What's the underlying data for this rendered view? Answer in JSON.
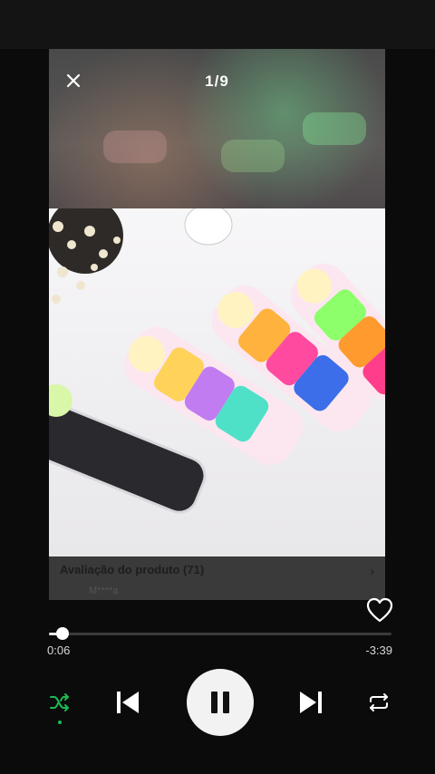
{
  "media": {
    "counter": "1/9",
    "review_title": "Avaliação do produto (71)",
    "review_user": "M****a"
  },
  "player": {
    "elapsed": "0:06",
    "remaining": "-3:39",
    "progress_fraction": 0.04,
    "shuffle_active": true,
    "accent_color": "#1db954"
  },
  "icons": {
    "close": "close-icon",
    "heart": "heart-icon",
    "shuffle": "shuffle-icon",
    "previous": "skip-previous-icon",
    "pause": "pause-icon",
    "next": "skip-next-icon",
    "repeat": "repeat-icon",
    "chevron": "chevron-right-icon"
  }
}
